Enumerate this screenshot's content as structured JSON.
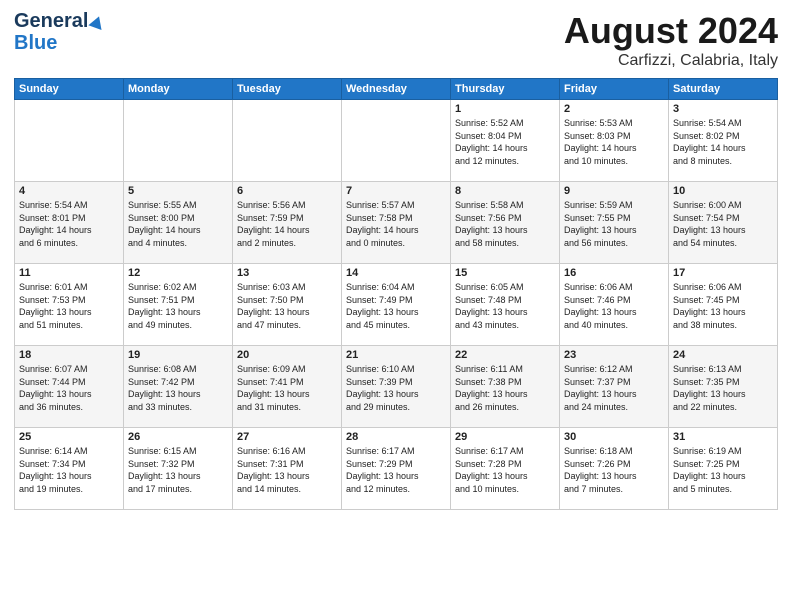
{
  "header": {
    "logo_general": "General",
    "logo_blue": "Blue",
    "month": "August 2024",
    "location": "Carfizzi, Calabria, Italy"
  },
  "days_of_week": [
    "Sunday",
    "Monday",
    "Tuesday",
    "Wednesday",
    "Thursday",
    "Friday",
    "Saturday"
  ],
  "weeks": [
    [
      {
        "day": "",
        "info": ""
      },
      {
        "day": "",
        "info": ""
      },
      {
        "day": "",
        "info": ""
      },
      {
        "day": "",
        "info": ""
      },
      {
        "day": "1",
        "info": "Sunrise: 5:52 AM\nSunset: 8:04 PM\nDaylight: 14 hours\nand 12 minutes."
      },
      {
        "day": "2",
        "info": "Sunrise: 5:53 AM\nSunset: 8:03 PM\nDaylight: 14 hours\nand 10 minutes."
      },
      {
        "day": "3",
        "info": "Sunrise: 5:54 AM\nSunset: 8:02 PM\nDaylight: 14 hours\nand 8 minutes."
      }
    ],
    [
      {
        "day": "4",
        "info": "Sunrise: 5:54 AM\nSunset: 8:01 PM\nDaylight: 14 hours\nand 6 minutes."
      },
      {
        "day": "5",
        "info": "Sunrise: 5:55 AM\nSunset: 8:00 PM\nDaylight: 14 hours\nand 4 minutes."
      },
      {
        "day": "6",
        "info": "Sunrise: 5:56 AM\nSunset: 7:59 PM\nDaylight: 14 hours\nand 2 minutes."
      },
      {
        "day": "7",
        "info": "Sunrise: 5:57 AM\nSunset: 7:58 PM\nDaylight: 14 hours\nand 0 minutes."
      },
      {
        "day": "8",
        "info": "Sunrise: 5:58 AM\nSunset: 7:56 PM\nDaylight: 13 hours\nand 58 minutes."
      },
      {
        "day": "9",
        "info": "Sunrise: 5:59 AM\nSunset: 7:55 PM\nDaylight: 13 hours\nand 56 minutes."
      },
      {
        "day": "10",
        "info": "Sunrise: 6:00 AM\nSunset: 7:54 PM\nDaylight: 13 hours\nand 54 minutes."
      }
    ],
    [
      {
        "day": "11",
        "info": "Sunrise: 6:01 AM\nSunset: 7:53 PM\nDaylight: 13 hours\nand 51 minutes."
      },
      {
        "day": "12",
        "info": "Sunrise: 6:02 AM\nSunset: 7:51 PM\nDaylight: 13 hours\nand 49 minutes."
      },
      {
        "day": "13",
        "info": "Sunrise: 6:03 AM\nSunset: 7:50 PM\nDaylight: 13 hours\nand 47 minutes."
      },
      {
        "day": "14",
        "info": "Sunrise: 6:04 AM\nSunset: 7:49 PM\nDaylight: 13 hours\nand 45 minutes."
      },
      {
        "day": "15",
        "info": "Sunrise: 6:05 AM\nSunset: 7:48 PM\nDaylight: 13 hours\nand 43 minutes."
      },
      {
        "day": "16",
        "info": "Sunrise: 6:06 AM\nSunset: 7:46 PM\nDaylight: 13 hours\nand 40 minutes."
      },
      {
        "day": "17",
        "info": "Sunrise: 6:06 AM\nSunset: 7:45 PM\nDaylight: 13 hours\nand 38 minutes."
      }
    ],
    [
      {
        "day": "18",
        "info": "Sunrise: 6:07 AM\nSunset: 7:44 PM\nDaylight: 13 hours\nand 36 minutes."
      },
      {
        "day": "19",
        "info": "Sunrise: 6:08 AM\nSunset: 7:42 PM\nDaylight: 13 hours\nand 33 minutes."
      },
      {
        "day": "20",
        "info": "Sunrise: 6:09 AM\nSunset: 7:41 PM\nDaylight: 13 hours\nand 31 minutes."
      },
      {
        "day": "21",
        "info": "Sunrise: 6:10 AM\nSunset: 7:39 PM\nDaylight: 13 hours\nand 29 minutes."
      },
      {
        "day": "22",
        "info": "Sunrise: 6:11 AM\nSunset: 7:38 PM\nDaylight: 13 hours\nand 26 minutes."
      },
      {
        "day": "23",
        "info": "Sunrise: 6:12 AM\nSunset: 7:37 PM\nDaylight: 13 hours\nand 24 minutes."
      },
      {
        "day": "24",
        "info": "Sunrise: 6:13 AM\nSunset: 7:35 PM\nDaylight: 13 hours\nand 22 minutes."
      }
    ],
    [
      {
        "day": "25",
        "info": "Sunrise: 6:14 AM\nSunset: 7:34 PM\nDaylight: 13 hours\nand 19 minutes."
      },
      {
        "day": "26",
        "info": "Sunrise: 6:15 AM\nSunset: 7:32 PM\nDaylight: 13 hours\nand 17 minutes."
      },
      {
        "day": "27",
        "info": "Sunrise: 6:16 AM\nSunset: 7:31 PM\nDaylight: 13 hours\nand 14 minutes."
      },
      {
        "day": "28",
        "info": "Sunrise: 6:17 AM\nSunset: 7:29 PM\nDaylight: 13 hours\nand 12 minutes."
      },
      {
        "day": "29",
        "info": "Sunrise: 6:17 AM\nSunset: 7:28 PM\nDaylight: 13 hours\nand 10 minutes."
      },
      {
        "day": "30",
        "info": "Sunrise: 6:18 AM\nSunset: 7:26 PM\nDaylight: 13 hours\nand 7 minutes."
      },
      {
        "day": "31",
        "info": "Sunrise: 6:19 AM\nSunset: 7:25 PM\nDaylight: 13 hours\nand 5 minutes."
      }
    ]
  ]
}
